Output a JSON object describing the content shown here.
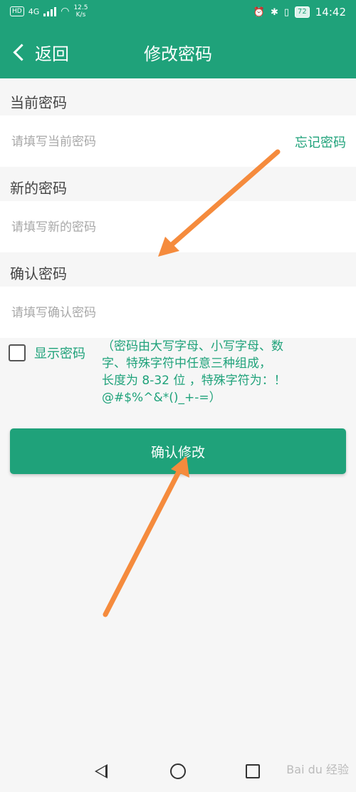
{
  "status_bar": {
    "hd": "HD",
    "net": "4G",
    "speed_value": "12.5",
    "speed_unit": "K/s",
    "battery": "72",
    "time": "14:42"
  },
  "header": {
    "back_label": "返回",
    "title": "修改密码"
  },
  "form": {
    "current": {
      "label": "当前密码",
      "placeholder": "请填写当前密码",
      "forgot": "忘记密码"
    },
    "new": {
      "label": "新的密码",
      "placeholder": "请填写新的密码"
    },
    "confirm": {
      "label": "确认密码",
      "placeholder": "请填写确认密码"
    },
    "show_password_label": "显示密码",
    "rule_lines": [
      "（密码由大写字母、小写字母、数",
      "字、特殊字符中任意三种组成，",
      "长度为 8-32 位 ，特殊字符为：！",
      "@#$%^&*()_+-=）"
    ],
    "confirm_button": "确认修改"
  },
  "watermark": "Bai du 经验",
  "colors": {
    "brand": "#1fa27a",
    "arrow": "#f58b3d"
  }
}
